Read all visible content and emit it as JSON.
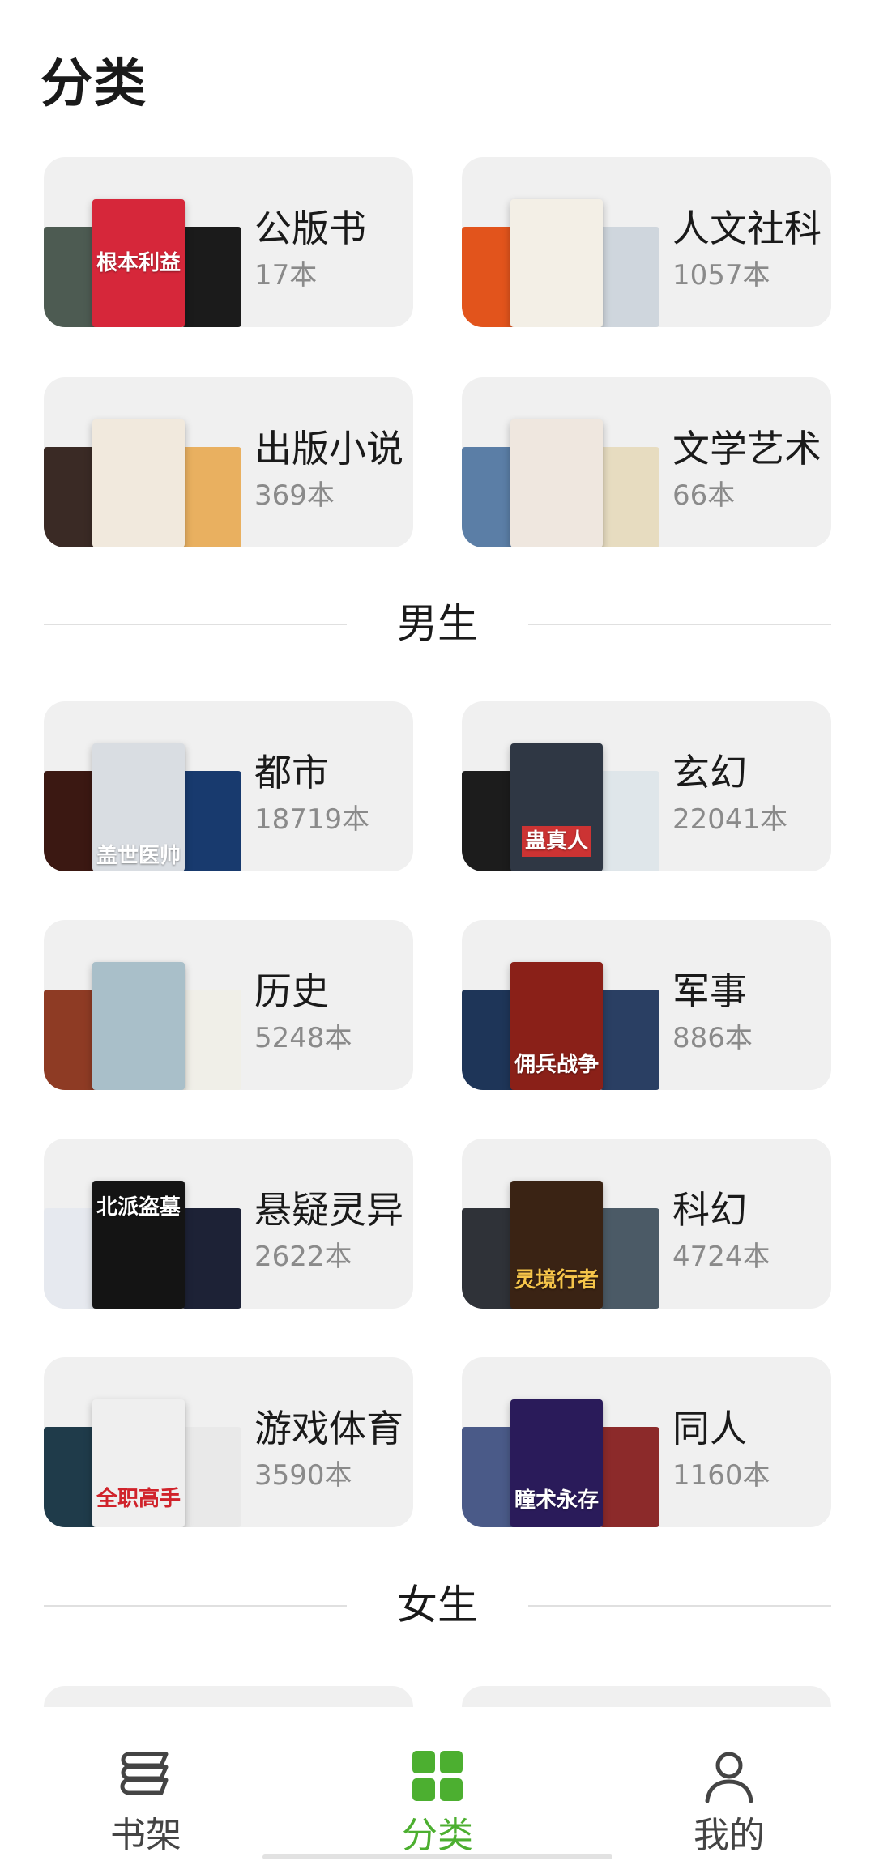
{
  "page": {
    "title": "分类"
  },
  "sections": [
    {
      "heading": "",
      "categories": [
        {
          "name": "公版书",
          "count": "17本",
          "covers": {
            "left": "#4d5b52",
            "main": "#d6273a",
            "right": "#1b1b1b",
            "main_text": "根本利益"
          }
        },
        {
          "name": "人文社科",
          "count": "1057本",
          "covers": {
            "left": "#e2541c",
            "main": "#f3efe6",
            "right": "#cfd6dd",
            "main_text": ""
          }
        },
        {
          "name": "出版小说",
          "count": "369本",
          "covers": {
            "left": "#3a2a25",
            "main": "#f1e9dd",
            "right": "#e9b060",
            "main_text": ""
          }
        },
        {
          "name": "文学艺术",
          "count": "66本",
          "covers": {
            "left": "#5b7ea6",
            "main": "#efe7df",
            "right": "#e7dcc0",
            "main_text": ""
          }
        }
      ]
    },
    {
      "heading": "男生",
      "categories": [
        {
          "name": "都市",
          "count": "18719本",
          "covers": {
            "left": "#3b1812",
            "main": "#d9dde2",
            "right": "#183a6e",
            "main_text": "盖世医帅"
          }
        },
        {
          "name": "玄幻",
          "count": "22041本",
          "covers": {
            "left": "#1c1c1c",
            "main": "#2f3744",
            "right": "#dfe6ea",
            "main_text": "蛊真人"
          }
        },
        {
          "name": "历史",
          "count": "5248本",
          "covers": {
            "left": "#8e3b24",
            "main": "#a9bfc9",
            "right": "#f0efe8",
            "main_text": ""
          }
        },
        {
          "name": "军事",
          "count": "886本",
          "covers": {
            "left": "#1e3558",
            "main": "#8a2018",
            "right": "#2a3f63",
            "main_text": "佣兵战争"
          }
        },
        {
          "name": "悬疑灵异",
          "count": "2622本",
          "covers": {
            "left": "#e6e9ef",
            "main": "#141414",
            "right": "#1d2236",
            "main_text": "北派盗墓"
          }
        },
        {
          "name": "科幻",
          "count": "4724本",
          "covers": {
            "left": "#2f3238",
            "main": "#3a2314",
            "right": "#4b5a66",
            "main_text": "灵境行者"
          }
        },
        {
          "name": "游戏体育",
          "count": "3590本",
          "covers": {
            "left": "#1f3b4a",
            "main": "#efefef",
            "right": "#e9e9e9",
            "main_text": "全职高手"
          }
        },
        {
          "name": "同人",
          "count": "1160本",
          "covers": {
            "left": "#4a5a88",
            "main": "#2a1b5a",
            "right": "#8c2a2a",
            "main_text": "瞳术永存"
          }
        }
      ]
    },
    {
      "heading": "女生",
      "categories": []
    }
  ],
  "tabbar": {
    "tabs": [
      {
        "label": "书架",
        "icon": "bookshelf-icon",
        "active": false
      },
      {
        "label": "分类",
        "icon": "category-grid-icon",
        "active": true
      },
      {
        "label": "我的",
        "icon": "profile-icon",
        "active": false
      }
    ],
    "active_color": "#4caf30",
    "inactive_color": "#444444"
  }
}
